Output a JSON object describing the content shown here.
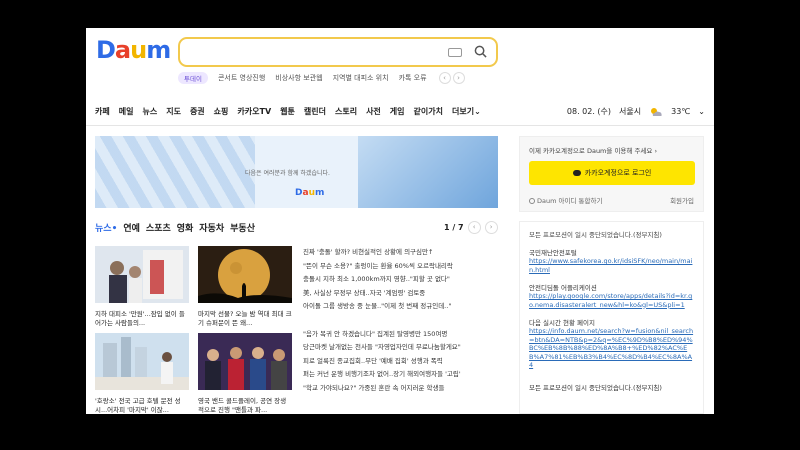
{
  "logo": "Daum",
  "issues": {
    "badge": "투데이",
    "items": [
      "콘서트 영상진행",
      "비상사항 보관웹",
      "지역별 대피소 위치",
      "카톡 오류"
    ],
    "prev": "‹",
    "next": "›"
  },
  "nav": {
    "items": [
      "카페",
      "메일",
      "뉴스",
      "지도",
      "증권",
      "쇼핑",
      "카카오TV",
      "웹툰",
      "캘린더",
      "스토리",
      "사전",
      "게임",
      "같이가치",
      "더보기"
    ],
    "more_arrow": "⌄",
    "date": "08. 02. (수)",
    "city": "서울시",
    "temp": "33℃",
    "city_arrow": "⌄"
  },
  "banner": {
    "text": "다음은 여러분과 함께 하겠습니다.",
    "logo": "Daum"
  },
  "news": {
    "tabs": [
      "뉴스",
      "연예",
      "스포츠",
      "영화",
      "자동차",
      "부동산"
    ],
    "page": "1 / 7",
    "prev": "‹",
    "next": "›",
    "cards": [
      {
        "caption": "지하 대피소 '만원'...잠입 없이 들어가는 사람들의..."
      },
      {
        "caption": "마지막 선물? 오늘 밤 역대 최대 크기 슈퍼문이 뜬 왜..."
      },
      {
        "caption": "'호랑소' 전국 고급 호텔 문전 성시...어차피 '마지막' 이잖..."
      },
      {
        "caption": "영국 밴드 콜드플레이, 공연 장생적으로 진행 \"맨틀과 파..."
      }
    ],
    "headlines": [
      "진짜 '충돌' 할까? 비현실적인 상황에 의구심만↑",
      "\"뜬이 무슨 소용?\" 출렁이는 환율 60%씩 오르락내리락",
      "충돌시 지하 최소 1,000km까지 영향..\"피할 곳 없다\"",
      "美, 사실상 무정부 상태..자국 '계엄령' 검토중",
      "아이돌 그룹 생방송 중 눈물..\"이제 첫 번째 정규인데..\"",
      "",
      "\"음가 복귀 안 하겠습니다\" 집계된 탈영병만 150여명",
      "당근마켓 날개없는 천사들 \"자영업자인데 무료나눔할게요\"",
      "피로 얼룩진 종교집회..무단 '예배 집회' 성행과 폭력",
      "펴는 커넌 운행 비행기조차 없어..장기 해외여행자들 '고립'",
      "\"학교 가야되나요?\" 가중된 혼란 속 어지러운 학생들"
    ]
  },
  "login": {
    "top": "이제 카카오계정으로 Daum을 이용해 주세요",
    "arrow": "›",
    "button": "카카오계정으로 로그인",
    "daum_id": "Daum 아이디 통합하기",
    "join": "회원가입"
  },
  "notice": {
    "header": "모든 프로모션이 일시 중단되었습니다.(정부지침)",
    "blocks": [
      {
        "title": "국민재난안전포털",
        "link": "https://www.safekorea.go.kr/idsiSFK/neo/main/main.html"
      },
      {
        "title": "안전디딤돌 어플리케이션",
        "link": "https://play.google.com/store/apps/details?id=kr.go.nema.disasteralert_new&hl=ko&gl=US&pli=1"
      },
      {
        "title": "다음 실시간 현황 페이지",
        "link": "https://info.daum.net/search?w=fusion&nil_search=btn&DA=NTB&p=2&q=%EC%9D%B8%ED%94%BC%EB%8B%88%ED%8A%B8+%ED%82%AC%EB%A7%81%EB%B3%B4%EC%8D%B4%EC%8A%A4"
      }
    ],
    "footer": "모든 프로모션이 일시 중단되었습니다.(정부지침)"
  },
  "colors": {
    "search_border": "#f2c94c",
    "kakao_yellow": "#fee500",
    "link_blue": "#2a6bb8",
    "news_active": "#2e6be6"
  }
}
